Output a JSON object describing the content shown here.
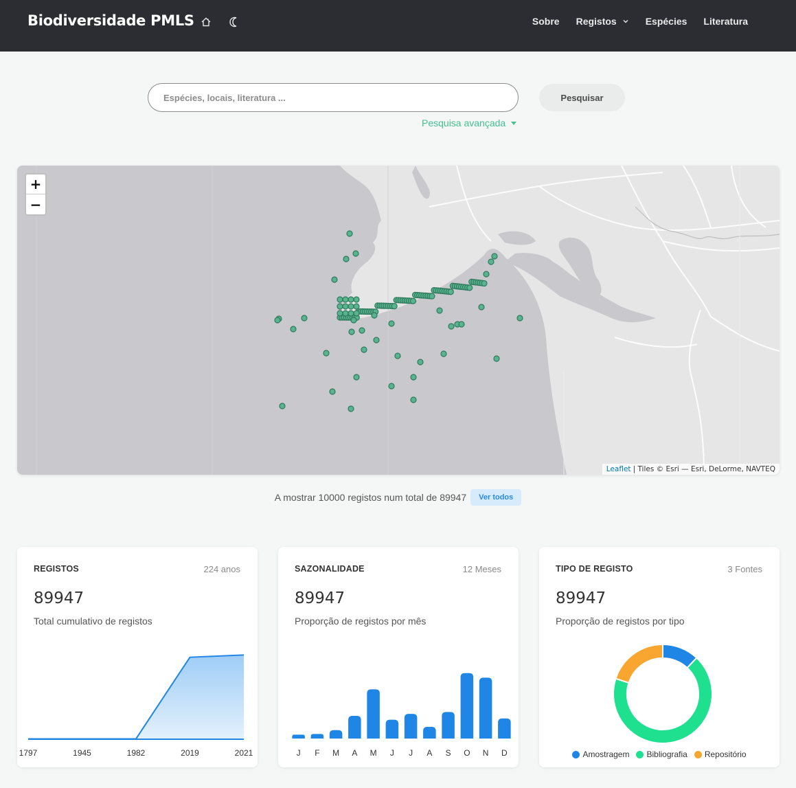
{
  "navbar": {
    "brand": "Biodiversidade PMLS",
    "home_icon": "home-icon",
    "theme_icon": "moon-icon",
    "links": [
      {
        "label": "Sobre"
      },
      {
        "label": "Registos",
        "has_dropdown": true
      },
      {
        "label": "Espécies"
      },
      {
        "label": "Literatura"
      }
    ]
  },
  "search": {
    "placeholder": "Espécies, locais, literatura ...",
    "value": "",
    "button": "Pesquisar",
    "advanced": "Pesquisa avançada"
  },
  "map": {
    "zoom_in": "+",
    "zoom_out": "−",
    "attribution_link": "Leaflet",
    "attribution_text": "| Tiles © Esri — Esri, DeLorme, NAVTEQ",
    "marker_color": "#5ab38f"
  },
  "records": {
    "text": "A mostrar 10000 registos num total de 89947",
    "button": "Ver todos"
  },
  "cards": {
    "registos": {
      "title": "REGISTOS",
      "meta": "224 anos",
      "value": "89947",
      "subtitle": "Total cumulativo de registos"
    },
    "sazonalidade": {
      "title": "SAZONALIDADE",
      "meta": "12 Meses",
      "value": "89947",
      "subtitle": "Proporção de registos por mês"
    },
    "tipo": {
      "title": "TIPO DE REGISTO",
      "meta": "3 Fontes",
      "value": "89947",
      "subtitle": "Proporção de registos por tipo"
    }
  },
  "chart_data": [
    {
      "type": "area",
      "x": [
        "1797",
        "1945",
        "1982",
        "2019",
        "2021"
      ],
      "x_numeric": [
        1797,
        1945,
        1982,
        2019,
        2021
      ],
      "values": [
        400,
        400,
        400,
        87500,
        89947
      ],
      "ylim": [
        0,
        110000
      ],
      "color": "#1f86e6"
    },
    {
      "type": "bar",
      "categories": [
        "J",
        "F",
        "M",
        "A",
        "M",
        "J",
        "J",
        "A",
        "S",
        "O",
        "N",
        "D"
      ],
      "values": [
        600,
        700,
        1300,
        3500,
        7600,
        2900,
        3800,
        1800,
        4100,
        10100,
        9400,
        3100
      ],
      "ylim": [
        0,
        10500
      ],
      "color": "#1f86e6"
    },
    {
      "type": "pie",
      "categories": [
        "Amostragem",
        "Bibliografia",
        "Repositório"
      ],
      "values": [
        12,
        68,
        20
      ],
      "colors": [
        "#1f86e6",
        "#1ee08f",
        "#f9a630"
      ]
    }
  ]
}
